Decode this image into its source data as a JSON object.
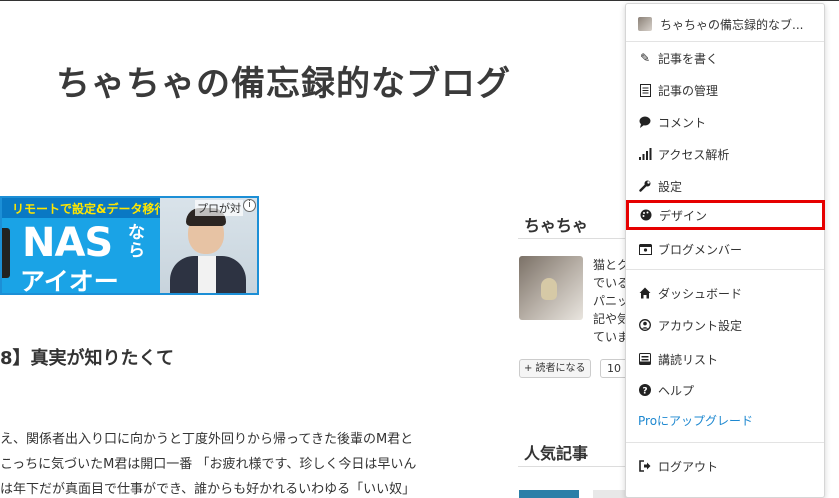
{
  "blog": {
    "title": "ちゃちゃの備忘録的なブログ"
  },
  "ad": {
    "tagline": "リモートで設定&データ移行",
    "product": "NAS",
    "nara": "なら",
    "brand": "アイオー",
    "pro_text": "プロが対",
    "info_icon": "info-icon"
  },
  "post": {
    "heading": "8】真実が知りたくて",
    "lines": [
      "え、関係者出入り口に向かうと丁度外回りから帰ってきた後輩のM君と",
      "こっちに気づいたM君は開口一番 「お疲れ様です、珍しく今日は早いん",
      "は年下だが真面目で仕事ができ、誰からも好かれるいわゆる「いい奴」"
    ]
  },
  "sidebar": {
    "profile_title": "ちゃちゃ",
    "profile_lines": [
      "猫とク",
      "でいる",
      "パニッ",
      "記や気",
      "ていま"
    ],
    "reader_button": "+ 読者になる",
    "reader_count": "10",
    "popular_title": "人気記事"
  },
  "menu": {
    "blog_name": "ちゃちゃの備忘録的なブ...",
    "items": [
      {
        "label": "記事を書く",
        "icon": "edit-icon",
        "glyph": "✎"
      },
      {
        "label": "記事の管理",
        "icon": "document-icon",
        "glyph": "▤"
      },
      {
        "label": "コメント",
        "icon": "comment-icon",
        "glyph": "●"
      },
      {
        "label": "アクセス解析",
        "icon": "bar-chart-icon",
        "glyph": "▂"
      },
      {
        "label": "設定",
        "icon": "wrench-icon",
        "glyph": "✚"
      },
      {
        "label": "デザイン",
        "icon": "palette-icon",
        "glyph": "◕"
      },
      {
        "label": "ブログメンバー",
        "icon": "members-icon",
        "glyph": "▣"
      }
    ],
    "items2": [
      {
        "label": "ダッシュボード",
        "icon": "home-icon",
        "glyph": "⌂"
      },
      {
        "label": "アカウント設定",
        "icon": "account-icon",
        "glyph": "◉"
      },
      {
        "label": "講読リスト",
        "icon": "reading-list-icon",
        "glyph": "▥"
      },
      {
        "label": "ヘルプ",
        "icon": "help-icon",
        "glyph": "?"
      }
    ],
    "upgrade": "Proにアップグレード",
    "logout": "ログアウト",
    "highlight_color": "#e60000",
    "link_color": "#1e88d0"
  }
}
